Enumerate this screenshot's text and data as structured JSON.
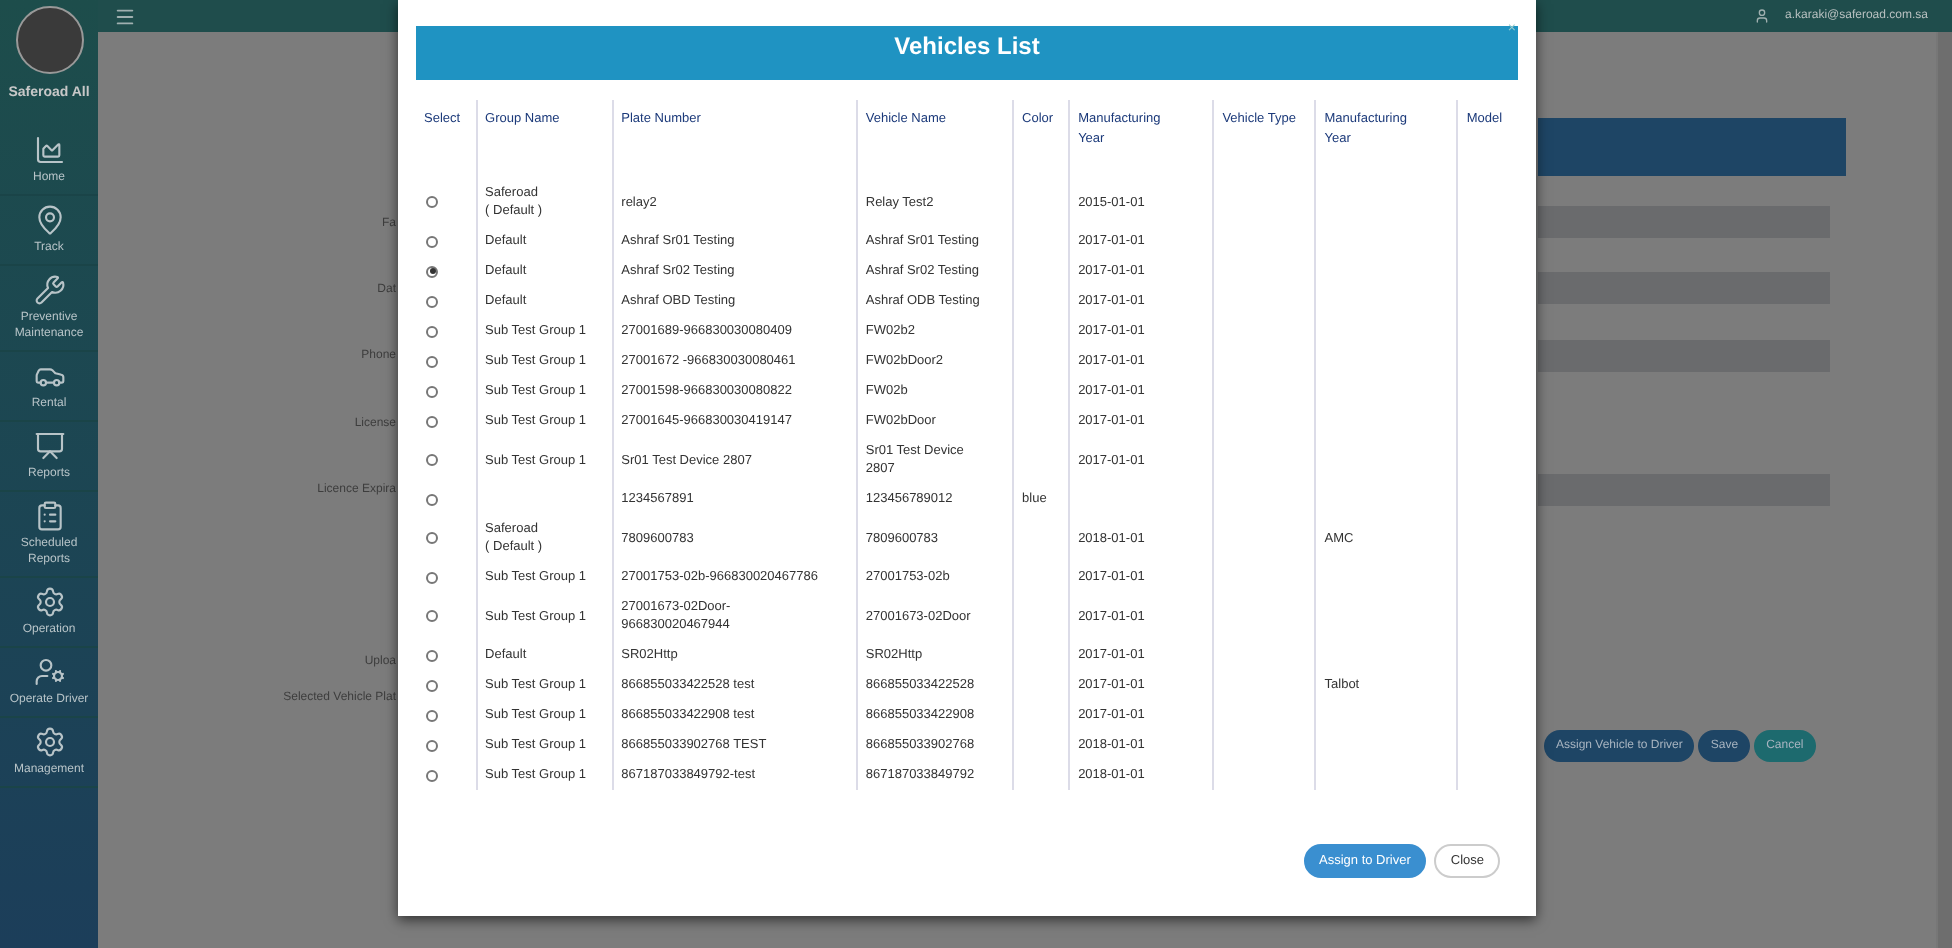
{
  "sidebar": {
    "user_name": "Saferoad All",
    "items": [
      {
        "label": "Home"
      },
      {
        "label": "Track"
      },
      {
        "label": "Preventive Maintenance"
      },
      {
        "label": "Rental"
      },
      {
        "label": "Reports"
      },
      {
        "label": "Scheduled Reports"
      },
      {
        "label": "Operation"
      },
      {
        "label": "Operate Driver"
      },
      {
        "label": "Management"
      }
    ]
  },
  "top_bar": {
    "email": "a.karaki@saferoad.com.sa"
  },
  "background_form": {
    "labels": [
      "Fa",
      "Dat",
      "Phone",
      "License",
      "Licence Expira",
      "Uploa",
      "Selected Vehicle Plat"
    ],
    "buttons": [
      {
        "label": "Assign Vehicle to Driver",
        "kind": "primary"
      },
      {
        "label": "Save",
        "kind": "primary"
      },
      {
        "label": "Cancel",
        "kind": "teal"
      }
    ]
  },
  "modal": {
    "title": "Vehicles List",
    "close": "×",
    "select_header": "Select",
    "columns": [
      "Group Name",
      "Plate Number",
      "Vehicle Name",
      "Color",
      "Manufacturing Year",
      "Vehicle Type",
      "Manufacturing Year",
      "Model"
    ],
    "rows": [
      {
        "selected": false,
        "cells": [
          "Saferoad\n( Default )",
          "relay2",
          "Relay Test2",
          "",
          "2015-01-01",
          "",
          "",
          ""
        ]
      },
      {
        "selected": false,
        "cells": [
          "Default",
          "Ashraf Sr01 Testing",
          "Ashraf Sr01 Testing",
          "",
          "2017-01-01",
          "",
          "",
          ""
        ]
      },
      {
        "selected": true,
        "cells": [
          "Default",
          "Ashraf Sr02 Testing",
          "Ashraf Sr02 Testing",
          "",
          "2017-01-01",
          "",
          "",
          ""
        ]
      },
      {
        "selected": false,
        "cells": [
          "Default",
          "Ashraf OBD Testing",
          "Ashraf ODB Testing",
          "",
          "2017-01-01",
          "",
          "",
          ""
        ]
      },
      {
        "selected": false,
        "cells": [
          "Sub Test Group 1",
          "27001689-966830030080409",
          "FW02b2",
          "",
          "2017-01-01",
          "",
          "",
          ""
        ]
      },
      {
        "selected": false,
        "cells": [
          "Sub Test Group 1",
          "27001672 -966830030080461",
          "FW02bDoor2",
          "",
          "2017-01-01",
          "",
          "",
          ""
        ]
      },
      {
        "selected": false,
        "cells": [
          "Sub Test Group 1",
          "27001598-966830030080822",
          "FW02b",
          "",
          "2017-01-01",
          "",
          "",
          ""
        ]
      },
      {
        "selected": false,
        "cells": [
          "Sub Test Group 1",
          "27001645-966830030419147",
          "FW02bDoor",
          "",
          "2017-01-01",
          "",
          "",
          ""
        ]
      },
      {
        "selected": false,
        "cells": [
          "Sub Test Group 1",
          "Sr01 Test Device 2807",
          "Sr01 Test Device\n2807",
          "",
          "2017-01-01",
          "",
          "",
          ""
        ]
      },
      {
        "selected": false,
        "cells": [
          "",
          "1234567891",
          "123456789012",
          "blue",
          "",
          "",
          "",
          ""
        ]
      },
      {
        "selected": false,
        "cells": [
          "Saferoad\n( Default )",
          "7809600783",
          "7809600783",
          "",
          "2018-01-01",
          "",
          "AMC",
          ""
        ]
      },
      {
        "selected": false,
        "cells": [
          "Sub Test Group 1",
          "27001753-02b-966830020467786",
          "27001753-02b",
          "",
          "2017-01-01",
          "",
          "",
          ""
        ]
      },
      {
        "selected": false,
        "cells": [
          "Sub Test Group 1",
          "27001673-02Door-\n966830020467944",
          "27001673-02Door",
          "",
          "2017-01-01",
          "",
          "",
          ""
        ]
      },
      {
        "selected": false,
        "cells": [
          "Default",
          "SR02Http",
          "SR02Http",
          "",
          "2017-01-01",
          "",
          "",
          ""
        ]
      },
      {
        "selected": false,
        "cells": [
          "Sub Test Group 1",
          "866855033422528 test",
          "866855033422528",
          "",
          "2017-01-01",
          "",
          "Talbot",
          ""
        ]
      },
      {
        "selected": false,
        "cells": [
          "Sub Test Group 1",
          "866855033422908 test",
          "866855033422908",
          "",
          "2017-01-01",
          "",
          "",
          ""
        ]
      },
      {
        "selected": false,
        "cells": [
          "Sub Test Group 1",
          "866855033902768 TEST",
          "866855033902768",
          "",
          "2018-01-01",
          "",
          "",
          ""
        ]
      },
      {
        "selected": false,
        "cells": [
          "Sub Test Group 1",
          "867187033849792-test",
          "867187033849792",
          "",
          "2018-01-01",
          "",
          "",
          ""
        ]
      }
    ],
    "buttons": [
      {
        "label": "Assign to Driver",
        "kind": "primary"
      },
      {
        "label": "Close",
        "kind": "outline"
      }
    ]
  }
}
